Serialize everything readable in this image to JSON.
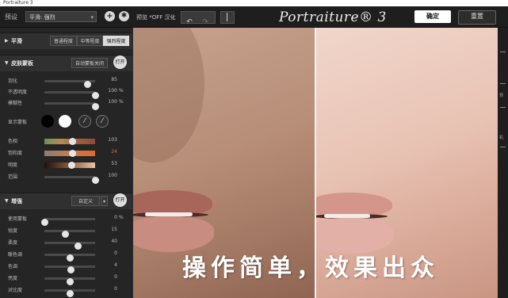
{
  "window": {
    "title": "Portraiture 3"
  },
  "toolbar": {
    "preset_label": "预设",
    "preset_value": "平滑: 强烈",
    "add_icon": "plus-icon",
    "settings_icon": "gear-icon",
    "preview_label": "预览 *OFF 汉化",
    "undo_icon": "undo-icon",
    "redo_icon": "redo-icon",
    "logo_text": "Portraiture® 3",
    "confirm_label": "确定",
    "reset_label": "重置"
  },
  "smoothing": {
    "title": "平滑",
    "buttons": [
      {
        "label": "普通程度",
        "active": false
      },
      {
        "label": "中等程度",
        "active": false
      },
      {
        "label": "强烈程度",
        "active": true
      }
    ]
  },
  "skin_mask": {
    "title": "皮肤蒙板",
    "auto_button": "自动蒙板关闭",
    "toggle_label": "打开",
    "sliders": [
      {
        "label": "羽化",
        "value": "85",
        "unit": "",
        "fraction": 0.85
      },
      {
        "label": "不透明度",
        "value": "100",
        "unit": "%",
        "fraction": 1.0
      },
      {
        "label": "模糊性",
        "value": "100",
        "unit": "%",
        "fraction": 1.0
      }
    ],
    "display_label": "显示蒙板",
    "swatch_colors": [
      "#000000",
      "#ffffff"
    ],
    "color_sliders": [
      {
        "label": "色相",
        "value": "103",
        "fraction": 0.55
      },
      {
        "label": "饱和度",
        "value": "24",
        "fraction": 0.55
      },
      {
        "label": "明度",
        "value": "53",
        "fraction": 0.53
      },
      {
        "label": "范围",
        "value": "100",
        "fraction": 1.0
      }
    ]
  },
  "enhance": {
    "title": "增强",
    "mode_value": "自定义",
    "toggle_label": "打开",
    "sliders": [
      {
        "label": "使用蒙板",
        "value": "0",
        "unit": "%",
        "fraction": 0.0
      },
      {
        "label": "锐度",
        "value": "15",
        "unit": "",
        "fraction": 0.4
      },
      {
        "label": "柔度",
        "value": "40",
        "unit": "",
        "fraction": 0.65
      },
      {
        "label": "暖色调",
        "value": "0",
        "unit": "",
        "fraction": 0.5
      },
      {
        "label": "色调",
        "value": "4",
        "unit": "",
        "fraction": 0.52
      },
      {
        "label": "亮度",
        "value": "0",
        "unit": "",
        "fraction": 0.5
      },
      {
        "label": "对比度",
        "value": "0",
        "unit": "",
        "fraction": 0.5
      }
    ]
  },
  "caption": "操作简单，效果出众",
  "right_labels": [
    "预",
    "机"
  ]
}
